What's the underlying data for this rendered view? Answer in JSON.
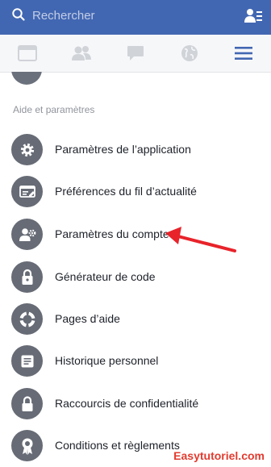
{
  "search": {
    "placeholder": "Rechercher",
    "icon": "search-icon"
  },
  "topbar": {
    "color": "#4267b2",
    "right_icon": "contacts-icon"
  },
  "nav": {
    "tabs": [
      {
        "icon": "news-feed-icon",
        "active": false
      },
      {
        "icon": "friends-icon",
        "active": false
      },
      {
        "icon": "messages-icon",
        "active": false
      },
      {
        "icon": "globe-icon",
        "active": false
      },
      {
        "icon": "menu-icon",
        "active": true
      }
    ],
    "active_color": "#4267b2",
    "inactive_color": "#d0d3d8"
  },
  "section": {
    "title": "Aide et paramètres"
  },
  "menu": {
    "items": [
      {
        "label": "Paramètres de l’application",
        "icon": "gear-icon"
      },
      {
        "label": "Préférences du fil d’actualité",
        "icon": "feed-preferences-icon"
      },
      {
        "label": "Paramètres du compte",
        "icon": "account-settings-icon"
      },
      {
        "label": "Générateur de code",
        "icon": "lock-icon"
      },
      {
        "label": "Pages d’aide",
        "icon": "lifebuoy-icon"
      },
      {
        "label": "Historique personnel",
        "icon": "activity-log-icon"
      },
      {
        "label": "Raccourcis de confidentialité",
        "icon": "padlock-icon"
      },
      {
        "label": "Conditions et règlements",
        "icon": "badge-icon"
      }
    ]
  },
  "annotation": {
    "arrow_color": "#e8232a",
    "target": "Paramètres du compte"
  },
  "watermark": {
    "text": "Easytutoriel.com"
  }
}
